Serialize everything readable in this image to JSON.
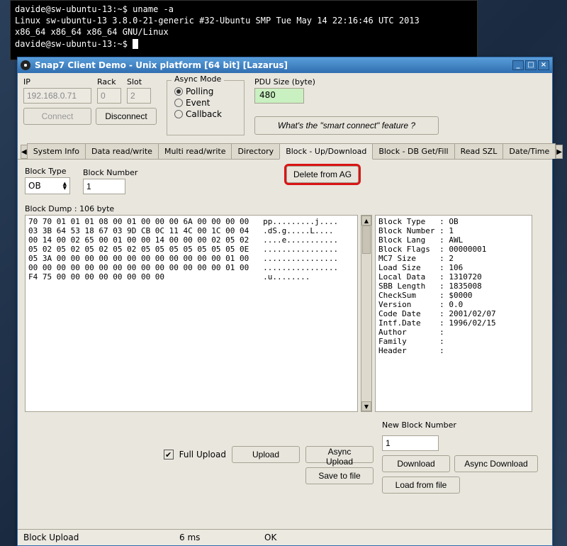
{
  "terminal": {
    "prompt1": "davide@sw-ubuntu-13:~$ ",
    "cmd1": "uname -a",
    "out1": "Linux sw-ubuntu-13 3.8.0-21-generic #32-Ubuntu SMP Tue May 14 22:16:46 UTC 2013",
    "out2": "x86_64 x86_64 x86_64 GNU/Linux",
    "prompt2": "davide@sw-ubuntu-13:~$ "
  },
  "window": {
    "title": "Snap7 Client Demo - Unix platform [64 bit] [Lazarus]"
  },
  "conn": {
    "ip_label": "IP",
    "ip_value": "192.168.0.71",
    "rack_label": "Rack",
    "rack_value": "0",
    "slot_label": "Slot",
    "slot_value": "2",
    "connect_label": "Connect",
    "disconnect_label": "Disconnect"
  },
  "async": {
    "title": "Async Mode",
    "polling": "Polling",
    "event": "Event",
    "callback": "Callback"
  },
  "pdu": {
    "label": "PDU Size (byte)",
    "value": "480",
    "smart_label": "What's the \"smart connect\" feature ?"
  },
  "tabs": {
    "items": [
      "System Info",
      "Data read/write",
      "Multi read/write",
      "Directory",
      "Block - Up/Download",
      "Block - DB Get/Fill",
      "Read SZL",
      "Date/Time"
    ],
    "active_index": 4
  },
  "block": {
    "type_label": "Block Type",
    "type_value": "OB",
    "num_label": "Block Number",
    "num_value": "1",
    "delete_label": "Delete from AG",
    "dump_label": "Block Dump : 106 byte",
    "dump_text": "70 70 01 01 01 08 00 01 00 00 00 6A 00 00 00 00   pp.........j....\n03 3B 64 53 18 67 03 9D CB 0C 11 4C 00 1C 00 04   .dS.g.....L....\n00 14 00 02 65 00 01 00 00 14 00 00 00 02 05 02   ....e...........\n05 02 05 02 05 02 05 02 05 05 05 05 05 05 05 0E   ................\n05 3A 00 00 00 00 00 00 00 00 00 00 00 00 01 00   ................\n00 00 00 00 00 00 00 00 00 00 00 00 00 00 01 00   ................\nF4 75 00 00 00 00 00 00 00 00                     .u........",
    "info_text": "Block Type   : OB\nBlock Number : 1\nBlock Lang   : AWL\nBlock Flags  : 00000001\nMC7 Size     : 2\nLoad Size    : 106\nLocal Data   : 1310720\nSBB Length   : 1835008\nCheckSum     : $0000\nVersion      : 0.0\nCode Date    : 2001/02/07\nIntf.Date    : 1996/02/15\nAuthor       :\nFamily       :\nHeader       :",
    "new_num_label": "New Block Number",
    "new_num_value": "1",
    "full_upload_label": "Full Upload",
    "upload_label": "Upload",
    "async_upload_label": "Async Upload",
    "save_label": "Save to file",
    "download_label": "Download",
    "async_download_label": "Async Download",
    "load_label": "Load from file"
  },
  "status": {
    "op": "Block Upload",
    "time": "6 ms",
    "result": "OK"
  }
}
